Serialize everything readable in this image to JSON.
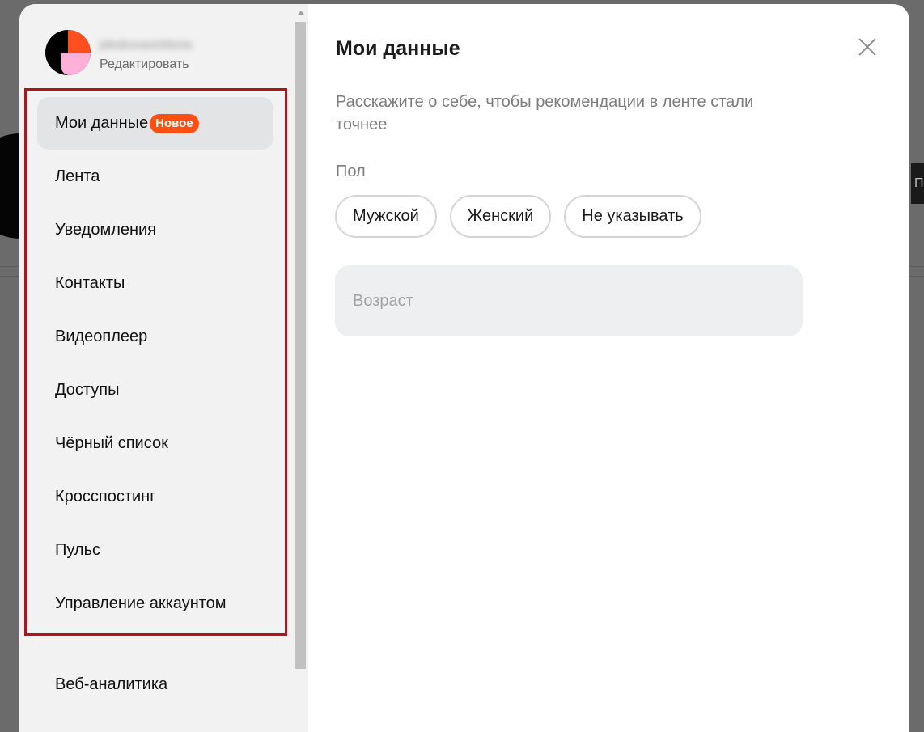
{
  "background": {
    "right_button_text": "П"
  },
  "profile": {
    "username": "pleskovavicktoria",
    "edit_label": "Редактировать"
  },
  "sidebar": {
    "items": [
      {
        "label": "Мои данные",
        "badge": "Новое",
        "active": true
      },
      {
        "label": "Лента"
      },
      {
        "label": "Уведомления"
      },
      {
        "label": "Контакты"
      },
      {
        "label": "Видеоплеер"
      },
      {
        "label": "Доступы"
      },
      {
        "label": "Чёрный список"
      },
      {
        "label": "Кросспостинг"
      },
      {
        "label": "Пульс"
      },
      {
        "label": "Управление аккаунтом"
      }
    ],
    "extra_items": [
      {
        "label": "Веб-аналитика"
      }
    ]
  },
  "content": {
    "title": "Мои данные",
    "subtitle": "Расскажите о себе, чтобы рекомендации в ленте стали точнее",
    "gender_label": "Пол",
    "gender_options": [
      "Мужской",
      "Женский",
      "Не указывать"
    ],
    "age_placeholder": "Возраст",
    "age_value": ""
  },
  "colors": {
    "accent": "#ff4f12",
    "highlight_border": "#b0141c",
    "sidebar_bg": "#f2f2f3"
  }
}
